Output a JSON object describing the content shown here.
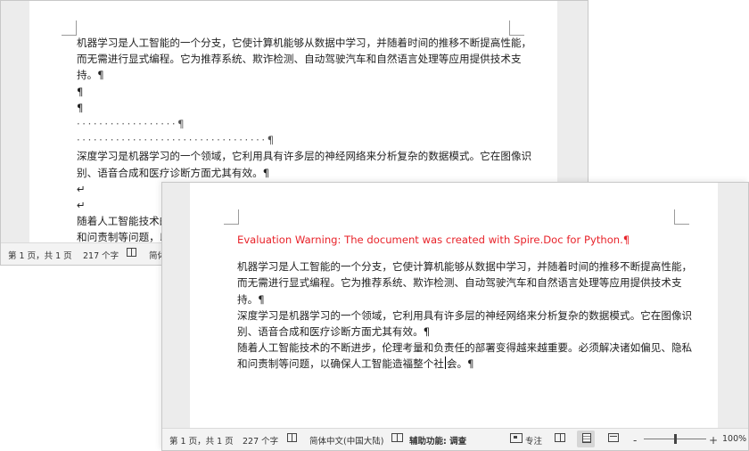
{
  "back_window": {
    "lines": [
      "机器学习是人工智能的一个分支，它使计算机能够从数据中学习，并随着时间的推移不断提高性能，",
      "而无需进行显式编程。它为推荐系统、欺诈检测、自动驾驶汽车和自然语言处理等应用提供技术支",
      "持。¶",
      "¶",
      "¶",
      "··················¶",
      "··································¶",
      "深度学习是机器学习的一个领域，它利用具有许多层的神经网络来分析复杂的数据模式。它在图像识",
      "别、语音合成和医疗诊断方面尤其有效。¶",
      "↵",
      "↵",
      "随着人工智能技术的",
      "和问责制等问题，以"
    ],
    "status": {
      "page": "第 1 页，共 1 页",
      "words": "217 个字",
      "language": "简体"
    }
  },
  "front_window": {
    "warning": "Evaluation Warning: The document was created with Spire.Doc for Python.¶",
    "lines": [
      "机器学习是人工智能的一个分支，它使计算机能够从数据中学习，并随着时间的推移不断提高性能，",
      "而无需进行显式编程。它为推荐系统、欺诈检测、自动驾驶汽车和自然语言处理等应用提供技术支",
      "持。¶",
      "深度学习是机器学习的一个领域，它利用具有许多层的神经网络来分析复杂的数据模式。它在图像识",
      "别、语音合成和医疗诊断方面尤其有效。¶",
      "随着人工智能技术的不断进步，伦理考量和负责任的部署变得越来越重要。必须解决诸如偏见、隐私"
    ],
    "last_line_before_caret": "和问责制等问题，以确保人工智能造福整个社",
    "last_line_after_caret": "会。¶",
    "status": {
      "page": "第 1 页，共 1 页",
      "words": "227 个字",
      "language": "简体中文(中国大陆)",
      "accessibility": "辅助功能: 调查",
      "focus": "专注",
      "zoom_minus": "-",
      "zoom_plus": "+",
      "zoom": "100%",
      "zoom_level_percent": 100
    }
  },
  "colors": {
    "warning": "#e8232a",
    "statusbar": "#f3f3f3",
    "workspace": "#ececec"
  }
}
